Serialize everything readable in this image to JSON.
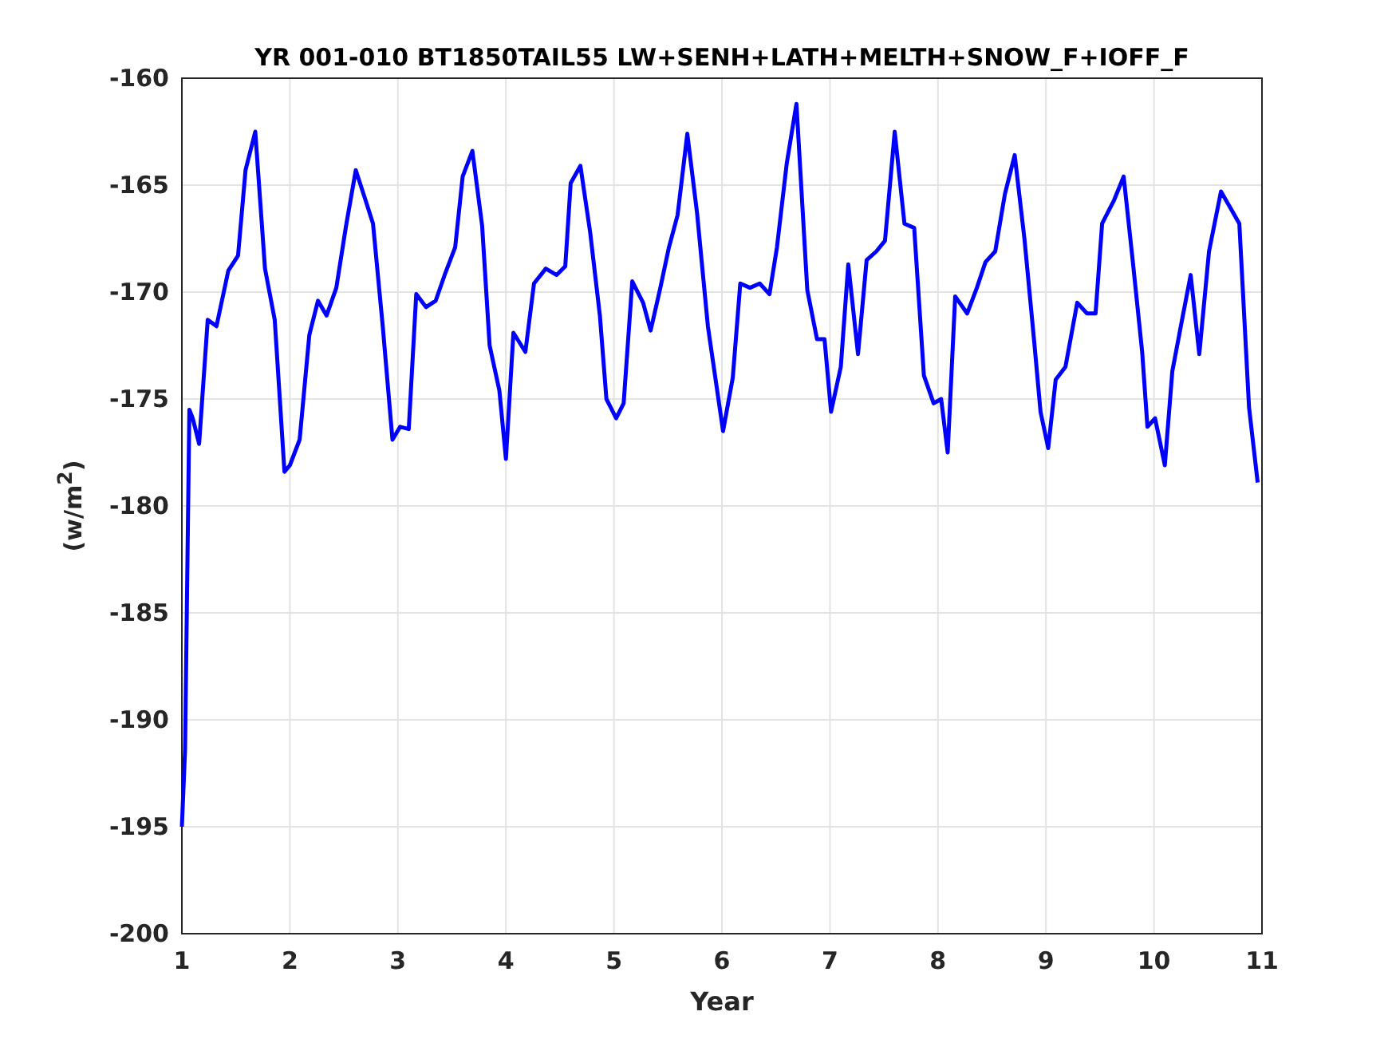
{
  "figure": {
    "chart_data": {
      "type": "line",
      "grid": true,
      "title": "YR 001-010 BT1850TAIL55 LW+SENH+LATH+MELTH+SNOW_F+IOFF_F",
      "xlabel": "Year",
      "ylabel": "(w/m$^{2}$)",
      "xlim": [
        1,
        11
      ],
      "ylim": [
        -200,
        -160
      ],
      "xticks": [
        1,
        2,
        3,
        4,
        5,
        6,
        7,
        8,
        9,
        10,
        11
      ],
      "yticks": [
        -200,
        -195,
        -190,
        -185,
        -180,
        -175,
        -170,
        -165,
        -160
      ],
      "x": [
        1.0,
        1.03,
        1.07,
        1.1,
        1.16,
        1.24,
        1.32,
        1.43,
        1.52,
        1.59,
        1.68,
        1.77,
        1.86,
        1.95,
        2.0,
        2.09,
        2.18,
        2.26,
        2.34,
        2.43,
        2.52,
        2.61,
        2.7,
        2.77,
        2.86,
        2.95,
        3.02,
        3.1,
        3.17,
        3.26,
        3.35,
        3.44,
        3.53,
        3.6,
        3.69,
        3.78,
        3.85,
        3.94,
        4.0,
        4.07,
        4.18,
        4.26,
        4.37,
        4.47,
        4.55,
        4.6,
        4.69,
        4.78,
        4.87,
        4.93,
        5.02,
        5.09,
        5.17,
        5.27,
        5.34,
        5.43,
        5.51,
        5.59,
        5.68,
        5.77,
        5.87,
        6.01,
        6.1,
        6.17,
        6.26,
        6.35,
        6.44,
        6.51,
        6.6,
        6.69,
        6.79,
        6.88,
        6.95,
        7.01,
        7.1,
        7.17,
        7.26,
        7.34,
        7.43,
        7.51,
        7.6,
        7.69,
        7.78,
        7.87,
        7.96,
        8.03,
        8.09,
        8.16,
        8.27,
        8.36,
        8.44,
        8.53,
        8.62,
        8.71,
        8.8,
        8.89,
        8.95,
        9.02,
        9.09,
        9.18,
        9.29,
        9.38,
        9.46,
        9.52,
        9.63,
        9.72,
        9.8,
        9.89,
        9.94,
        10.01,
        10.1,
        10.17,
        10.26,
        10.34,
        10.42,
        10.51,
        10.62,
        10.7,
        10.79,
        10.88,
        10.96
      ],
      "series": [
        {
          "color": "#0000ff",
          "values": [
            -195.0,
            -191.4,
            -175.5,
            -175.9,
            -177.1,
            -171.3,
            -171.6,
            -169.0,
            -168.3,
            -164.3,
            -162.5,
            -168.9,
            -171.3,
            -178.4,
            -178.1,
            -176.9,
            -172.0,
            -170.4,
            -171.1,
            -169.8,
            -166.9,
            -164.3,
            -165.7,
            -166.8,
            -171.6,
            -176.9,
            -176.3,
            -176.4,
            -170.1,
            -170.7,
            -170.4,
            -169.1,
            -167.9,
            -164.6,
            -163.4,
            -166.9,
            -172.5,
            -174.6,
            -177.8,
            -171.9,
            -172.8,
            -169.6,
            -168.9,
            -169.2,
            -168.8,
            -164.9,
            -164.1,
            -167.2,
            -171.1,
            -175.0,
            -175.9,
            -175.2,
            -169.5,
            -170.5,
            -171.8,
            -169.8,
            -167.9,
            -166.4,
            -162.6,
            -166.3,
            -171.6,
            -176.5,
            -174.0,
            -169.6,
            -169.8,
            -169.6,
            -170.1,
            -167.9,
            -164.0,
            -161.2,
            -169.9,
            -172.2,
            -172.2,
            -175.6,
            -173.5,
            -168.7,
            -172.9,
            -168.5,
            -168.1,
            -167.6,
            -162.5,
            -166.8,
            -167.0,
            -173.9,
            -175.2,
            -175.0,
            -177.5,
            -170.2,
            -171.0,
            -169.8,
            -168.6,
            -168.1,
            -165.4,
            -163.6,
            -167.5,
            -172.3,
            -175.6,
            -177.3,
            -174.1,
            -173.5,
            -170.5,
            -171.0,
            -171.0,
            -166.8,
            -165.7,
            -164.6,
            -168.4,
            -172.8,
            -176.3,
            -175.9,
            -178.1,
            -173.7,
            -171.3,
            -169.2,
            -172.9,
            -168.1,
            -165.3,
            -166.0,
            -166.8,
            -175.4,
            -178.9
          ]
        }
      ]
    }
  }
}
